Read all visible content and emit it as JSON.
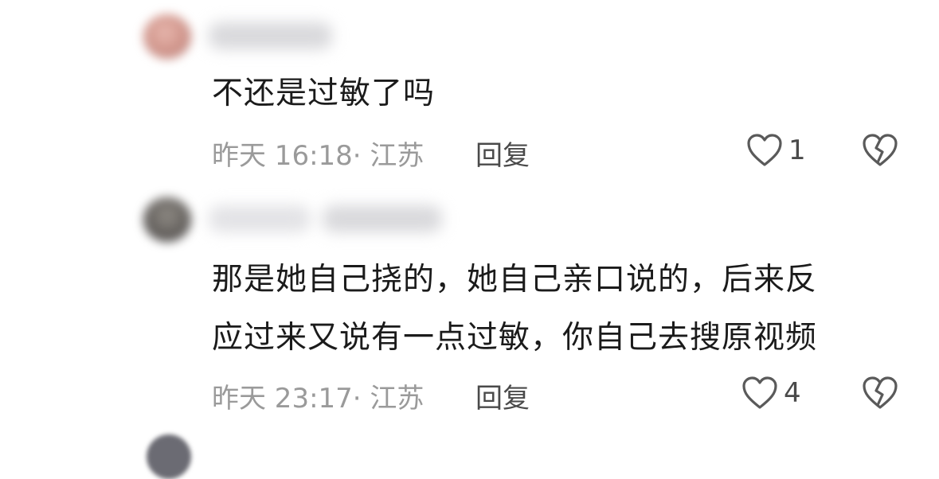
{
  "comments": [
    {
      "text": "不还是过敏了吗",
      "time": "昨天 16:18",
      "location": "江苏",
      "meta": "昨天 16:18· 江苏",
      "reply_label": "回复",
      "like_count": "1"
    },
    {
      "text_lines": [
        "那是她自己挠的，她自己亲口说的，后来反",
        "应过来又说有一点过敏，你自己去搜原视频"
      ],
      "time": "昨天 23:17",
      "location": "江苏",
      "meta": "昨天 23:17· 江苏",
      "reply_label": "回复",
      "like_count": "4"
    }
  ],
  "icons": {
    "like": "heart-outline-icon",
    "dislike": "broken-heart-icon"
  },
  "colors": {
    "text_primary": "#1b1b1b",
    "text_meta": "#9a9a9a",
    "text_action": "#4a4a4a"
  }
}
